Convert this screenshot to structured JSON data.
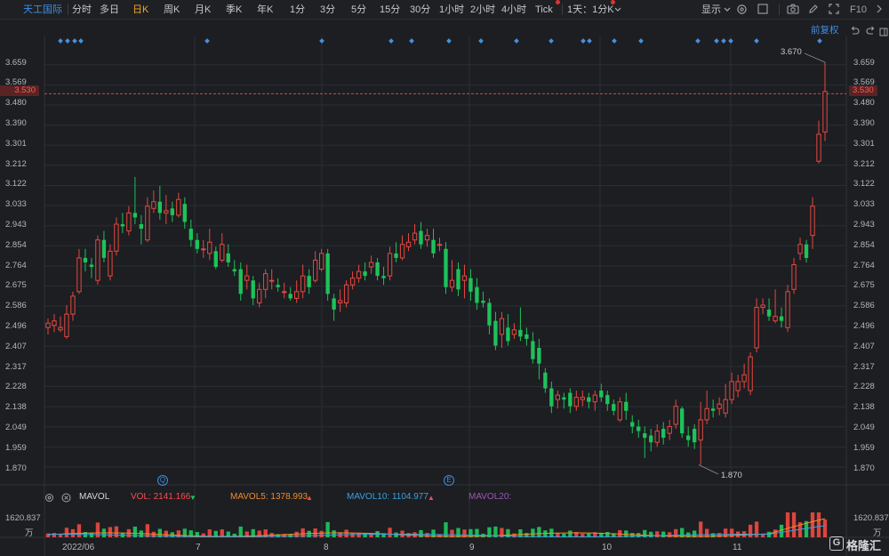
{
  "toolbar": {
    "stock_name": "天工国际",
    "periods": [
      "分时",
      "多日",
      "日K",
      "周K",
      "月K",
      "季K",
      "年K",
      "1分",
      "3分",
      "5分",
      "15分",
      "30分",
      "1小时",
      "2小时",
      "4小时",
      "Tick"
    ],
    "active_period": "日K",
    "custom_period": "1天：1分K",
    "display_label": "显示",
    "f10_label": "F10"
  },
  "restore_label": "前复权",
  "y_axis": {
    "ticks": [
      "3.659",
      "3.569",
      "3.480",
      "3.390",
      "3.301",
      "3.212",
      "3.122",
      "3.033",
      "2.943",
      "2.854",
      "2.764",
      "2.675",
      "2.586",
      "2.496",
      "2.407",
      "2.317",
      "2.228",
      "2.138",
      "2.049",
      "1.959",
      "1.870"
    ],
    "current_price": "3.530",
    "high_marker": "3.670",
    "low_marker": "1.870"
  },
  "event_markers": {
    "q_label": "Q",
    "e_label": "E"
  },
  "x_axis": {
    "labels": [
      "2022/06",
      "7",
      "8",
      "9",
      "10",
      "11"
    ]
  },
  "volume": {
    "indicator": "MAVOL",
    "vol": "VOL: 2141.166",
    "mavol5": "MAVOL5: 1378.993",
    "mavol10": "MAVOL10: 1104.977",
    "mavol20": "MAVOL20:",
    "axis_value": "1620.837",
    "axis_unit": "万"
  },
  "watermark": "格隆汇",
  "colors": {
    "up": "#e8473f",
    "down": "#1ec25a",
    "accent": "#f5a623",
    "link": "#3d8ee8"
  },
  "chart_data": {
    "type": "candlestick",
    "ylim": [
      1.87,
      3.67
    ],
    "candles": [
      [
        2.49,
        2.51,
        2.53,
        2.46
      ],
      [
        2.5,
        2.52,
        2.55,
        2.47
      ],
      [
        2.48,
        2.49,
        2.54,
        2.47
      ],
      [
        2.45,
        2.55,
        2.59,
        2.44
      ],
      [
        2.55,
        2.63,
        2.65,
        2.52
      ],
      [
        2.65,
        2.8,
        2.84,
        2.64
      ],
      [
        2.8,
        2.78,
        2.84,
        2.74
      ],
      [
        2.77,
        2.76,
        2.8,
        2.71
      ],
      [
        2.7,
        2.88,
        2.9,
        2.68
      ],
      [
        2.88,
        2.8,
        2.92,
        2.78
      ],
      [
        2.72,
        2.83,
        2.86,
        2.7
      ],
      [
        2.83,
        2.95,
        2.98,
        2.81
      ],
      [
        2.95,
        2.94,
        3.0,
        2.91
      ],
      [
        2.92,
        3.0,
        3.03,
        2.9
      ],
      [
        3.0,
        2.98,
        3.16,
        2.95
      ],
      [
        2.95,
        2.93,
        2.99,
        2.86
      ],
      [
        2.88,
        3.03,
        3.07,
        2.87
      ],
      [
        3.02,
        3.05,
        3.1,
        3.0
      ],
      [
        3.05,
        3.0,
        3.12,
        2.97
      ],
      [
        3.0,
        3.01,
        3.08,
        2.95
      ],
      [
        3.02,
        2.99,
        3.05,
        2.96
      ],
      [
        2.99,
        3.06,
        3.09,
        2.98
      ],
      [
        3.04,
        2.96,
        3.07,
        2.93
      ],
      [
        2.93,
        2.88,
        2.97,
        2.85
      ],
      [
        2.88,
        2.84,
        2.91,
        2.82
      ],
      [
        2.84,
        2.84,
        2.88,
        2.8
      ],
      [
        2.82,
        2.87,
        2.93,
        2.79
      ],
      [
        2.83,
        2.76,
        2.85,
        2.75
      ],
      [
        2.79,
        2.86,
        2.91,
        2.78
      ],
      [
        2.82,
        2.78,
        2.86,
        2.76
      ],
      [
        2.75,
        2.74,
        2.79,
        2.72
      ],
      [
        2.75,
        2.64,
        2.78,
        2.61
      ],
      [
        2.7,
        2.72,
        2.77,
        2.66
      ],
      [
        2.7,
        2.62,
        2.72,
        2.59
      ],
      [
        2.6,
        2.66,
        2.69,
        2.58
      ],
      [
        2.66,
        2.73,
        2.75,
        2.62
      ],
      [
        2.7,
        2.7,
        2.75,
        2.66
      ],
      [
        2.68,
        2.67,
        2.71,
        2.65
      ],
      [
        2.65,
        2.65,
        2.69,
        2.62
      ],
      [
        2.64,
        2.62,
        2.67,
        2.61
      ],
      [
        2.62,
        2.65,
        2.7,
        2.6
      ],
      [
        2.65,
        2.72,
        2.77,
        2.62
      ],
      [
        2.72,
        2.67,
        2.75,
        2.64
      ],
      [
        2.7,
        2.79,
        2.83,
        2.69
      ],
      [
        2.75,
        2.82,
        2.84,
        2.74
      ],
      [
        2.82,
        2.64,
        2.84,
        2.61
      ],
      [
        2.62,
        2.57,
        2.64,
        2.52
      ],
      [
        2.6,
        2.61,
        2.66,
        2.56
      ],
      [
        2.6,
        2.68,
        2.7,
        2.58
      ],
      [
        2.68,
        2.71,
        2.74,
        2.66
      ],
      [
        2.71,
        2.74,
        2.77,
        2.69
      ],
      [
        2.74,
        2.72,
        2.78,
        2.7
      ],
      [
        2.76,
        2.78,
        2.81,
        2.73
      ],
      [
        2.78,
        2.72,
        2.8,
        2.7
      ],
      [
        2.72,
        2.71,
        2.76,
        2.68
      ],
      [
        2.72,
        2.82,
        2.85,
        2.7
      ],
      [
        2.82,
        2.8,
        2.87,
        2.78
      ],
      [
        2.8,
        2.86,
        2.9,
        2.79
      ],
      [
        2.85,
        2.87,
        2.91,
        2.83
      ],
      [
        2.88,
        2.91,
        2.95,
        2.86
      ],
      [
        2.92,
        2.86,
        2.96,
        2.84
      ],
      [
        2.88,
        2.9,
        2.93,
        2.85
      ],
      [
        2.88,
        2.82,
        2.93,
        2.8
      ],
      [
        2.86,
        2.86,
        2.89,
        2.83
      ],
      [
        2.84,
        2.67,
        2.87,
        2.64
      ],
      [
        2.67,
        2.7,
        2.79,
        2.65
      ],
      [
        2.75,
        2.66,
        2.78,
        2.63
      ],
      [
        2.7,
        2.72,
        2.77,
        2.62
      ],
      [
        2.71,
        2.65,
        2.75,
        2.61
      ],
      [
        2.67,
        2.6,
        2.71,
        2.57
      ],
      [
        2.61,
        2.6,
        2.65,
        2.58
      ],
      [
        2.6,
        2.5,
        2.62,
        2.46
      ],
      [
        2.52,
        2.41,
        2.56,
        2.39
      ],
      [
        2.46,
        2.53,
        2.56,
        2.4
      ],
      [
        2.49,
        2.43,
        2.55,
        2.41
      ],
      [
        2.46,
        2.48,
        2.51,
        2.44
      ],
      [
        2.48,
        2.45,
        2.58,
        2.43
      ],
      [
        2.46,
        2.44,
        2.49,
        2.41
      ],
      [
        2.43,
        2.35,
        2.47,
        2.33
      ],
      [
        2.4,
        2.33,
        2.44,
        2.26
      ],
      [
        2.29,
        2.22,
        2.31,
        2.2
      ],
      [
        2.22,
        2.14,
        2.25,
        2.11
      ],
      [
        2.17,
        2.19,
        2.21,
        2.13
      ],
      [
        2.18,
        2.17,
        2.2,
        2.13
      ],
      [
        2.2,
        2.14,
        2.22,
        2.11
      ],
      [
        2.14,
        2.18,
        2.21,
        2.12
      ],
      [
        2.17,
        2.18,
        2.21,
        2.14
      ],
      [
        2.18,
        2.16,
        2.2,
        2.13
      ],
      [
        2.16,
        2.19,
        2.21,
        2.12
      ],
      [
        2.21,
        2.18,
        2.24,
        2.16
      ],
      [
        2.19,
        2.15,
        2.21,
        2.12
      ],
      [
        2.15,
        2.12,
        2.17,
        2.1
      ],
      [
        2.08,
        2.16,
        2.18,
        2.07
      ],
      [
        2.16,
        2.12,
        2.2,
        2.08
      ],
      [
        2.07,
        2.05,
        2.1,
        2.02
      ],
      [
        2.05,
        2.03,
        2.08,
        2.0
      ],
      [
        2.02,
        2.0,
        2.05,
        1.91
      ],
      [
        2.01,
        1.98,
        2.04,
        1.94
      ],
      [
        1.98,
        2.03,
        2.06,
        1.96
      ],
      [
        2.04,
        2.0,
        2.07,
        1.97
      ],
      [
        2.02,
        2.05,
        2.08,
        1.99
      ],
      [
        2.06,
        2.14,
        2.17,
        2.04
      ],
      [
        2.13,
        2.02,
        2.14,
        2.0
      ],
      [
        2.01,
        1.99,
        2.05,
        1.96
      ],
      [
        2.04,
        1.98,
        2.06,
        1.95
      ],
      [
        1.99,
        2.08,
        2.16,
        1.88
      ],
      [
        2.08,
        2.13,
        2.21,
        2.06
      ],
      [
        2.13,
        2.12,
        2.17,
        2.09
      ],
      [
        2.13,
        2.15,
        2.18,
        2.1
      ],
      [
        2.11,
        2.17,
        2.24,
        2.09
      ],
      [
        2.17,
        2.25,
        2.29,
        2.15
      ],
      [
        2.21,
        2.25,
        2.28,
        2.18
      ],
      [
        2.25,
        2.28,
        2.33,
        2.22
      ],
      [
        2.21,
        2.36,
        2.38,
        2.19
      ],
      [
        2.4,
        2.58,
        2.62,
        2.38
      ],
      [
        2.58,
        2.59,
        2.62,
        2.55
      ],
      [
        2.57,
        2.54,
        2.62,
        2.52
      ],
      [
        2.52,
        2.54,
        2.66,
        2.51
      ],
      [
        2.54,
        2.52,
        2.58,
        2.49
      ],
      [
        2.49,
        2.65,
        2.68,
        2.47
      ],
      [
        2.66,
        2.77,
        2.8,
        2.64
      ],
      [
        2.82,
        2.86,
        2.89,
        2.79
      ],
      [
        2.86,
        2.8,
        2.88,
        2.78
      ],
      [
        2.9,
        3.03,
        3.07,
        2.84
      ],
      [
        3.23,
        3.35,
        3.41,
        3.22
      ],
      [
        3.36,
        3.54,
        3.67,
        3.32
      ]
    ],
    "volume_units": "万",
    "volume_max": 1620.837
  }
}
